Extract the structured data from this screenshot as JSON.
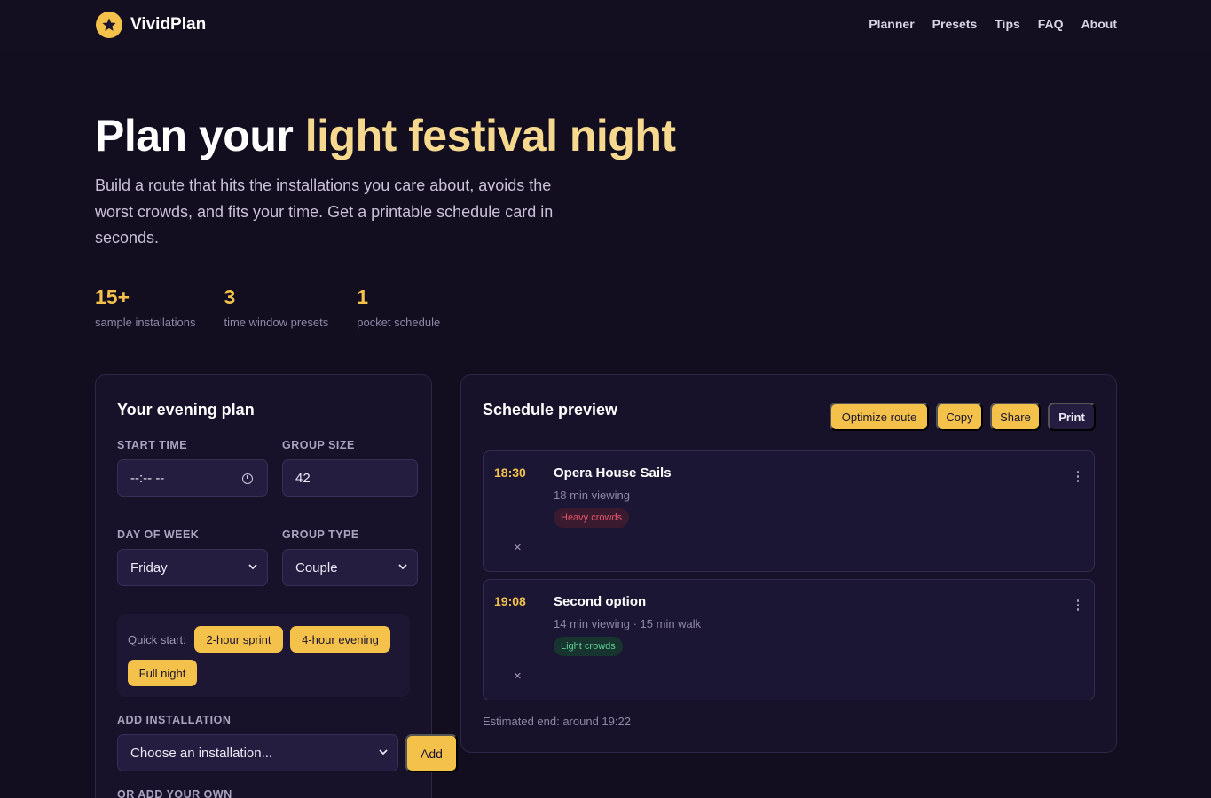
{
  "app": {
    "name": "VividPlan",
    "nav": [
      "Planner",
      "Presets",
      "Tips",
      "FAQ",
      "About"
    ]
  },
  "colors": {
    "background": "#120d1f",
    "accent": "#f4c24a",
    "heavy_crowds": "#e2556a",
    "light_crowds": "#5fcf94"
  },
  "hero": {
    "title_white": "Plan your",
    "title_gold": "light festival night",
    "subtitle": "Build a route that hits the installations you care about, avoids the worst crowds, and fits your time. Get a printable schedule card in seconds.",
    "stats": [
      {
        "value": "15+",
        "label": "sample installations"
      },
      {
        "value": "3",
        "label": "time window presets"
      },
      {
        "value": "1",
        "label": "pocket schedule"
      }
    ]
  },
  "plan": {
    "title": "Your evening plan",
    "start_time_label": "START TIME",
    "start_time_value": "--:-- --",
    "group_size_label": "GROUP SIZE",
    "group_size_value": "42",
    "day_label": "DAY OF WEEK",
    "day_value": "Friday",
    "group_type_label": "GROUP TYPE",
    "group_type_value": "Couple",
    "quick_label": "Quick start:",
    "presets": [
      "2-hour sprint",
      "4-hour evening",
      "Full night"
    ],
    "add_label": "ADD INSTALLATION",
    "add_select": "Choose an installation...",
    "add_button": "Add",
    "own_label": "OR ADD YOUR OWN"
  },
  "preview": {
    "title": "Schedule preview",
    "actions": [
      "Optimize route",
      "Copy",
      "Share",
      "Print"
    ],
    "items": [
      {
        "time": "18:30",
        "name": "Opera House Sails",
        "meta": "18 min viewing",
        "crowd": "Heavy crowds",
        "remove": "×"
      },
      {
        "time": "19:08",
        "name": "Second option",
        "meta": "14 min viewing · 15 min walk",
        "crowd": "Light crowds",
        "remove": "×"
      }
    ],
    "estimate": "Estimated end: around 19:22"
  }
}
